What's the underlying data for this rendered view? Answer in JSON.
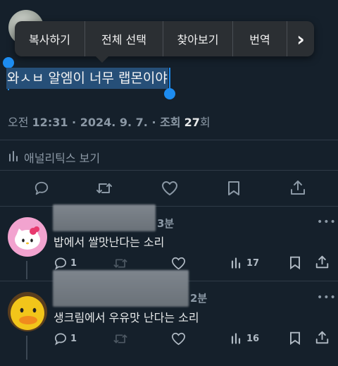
{
  "context_menu": {
    "items": [
      "복사하기",
      "전체 선택",
      "찾아보기",
      "번역"
    ],
    "more_glyph": "›"
  },
  "post": {
    "text": "와ㅅㅂ 알엠이 너무 랩몬이야",
    "time_prefix": "오전",
    "timestamp": "12:31 · 2024. 9. 7. · 조회",
    "views": "27",
    "views_suffix": "회",
    "analytics_label": "애널리틱스 보기"
  },
  "replies": [
    {
      "time": "3분",
      "text": "밥에서 쌀맛난다는 소리",
      "replies_count": "1",
      "views": "17"
    },
    {
      "time": "2분",
      "text": "생크림에서 우유맛 난다는 소리",
      "replies_count": "1",
      "views": "16"
    }
  ],
  "colors": {
    "background": "#15202b",
    "selection": "#264f78",
    "handle": "#1d8cf0",
    "menu": "#2b2f33",
    "muted": "#8b98a5"
  },
  "icons": [
    "reply-icon",
    "retweet-icon",
    "like-icon",
    "bookmark-icon",
    "share-icon",
    "analytics-icon",
    "more-icon"
  ]
}
